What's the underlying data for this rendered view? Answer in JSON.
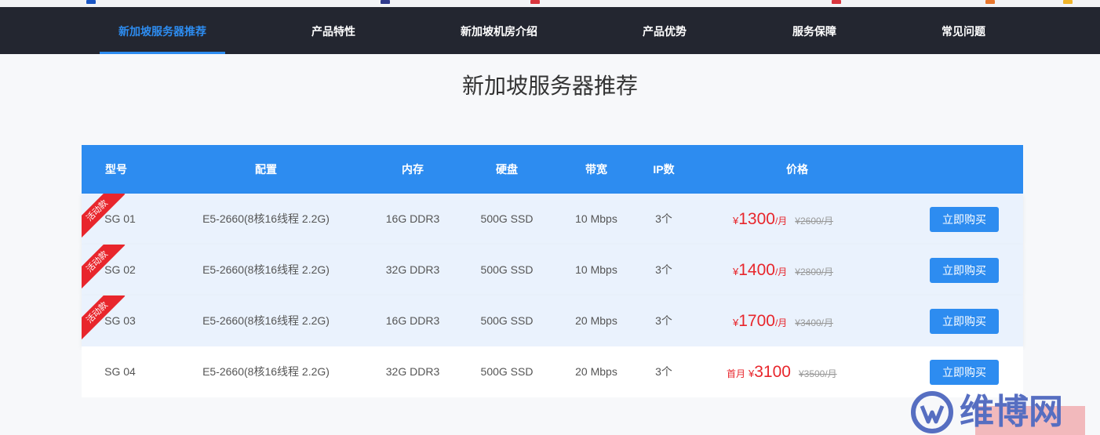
{
  "nav": {
    "items": [
      {
        "label": "新加坡服务器推荐",
        "active": true
      },
      {
        "label": "产品特性",
        "active": false
      },
      {
        "label": "新加坡机房介绍",
        "active": false
      },
      {
        "label": "产品优势",
        "active": false
      },
      {
        "label": "服务保障",
        "active": false
      },
      {
        "label": "常见问题",
        "active": false
      }
    ]
  },
  "page_title": "新加坡服务器推荐",
  "table": {
    "headers": [
      "型号",
      "配置",
      "内存",
      "硬盘",
      "带宽",
      "IP数",
      "价格",
      ""
    ],
    "rows": [
      {
        "promo": true,
        "ribbon": "活动款",
        "model": "SG 01",
        "config": "E5-2660(8核16线程 2.2G)",
        "memory": "16G DDR3",
        "disk": "500G SSD",
        "bandwidth": "10 Mbps",
        "ip": "3个",
        "price_prefix": "",
        "currency": "¥",
        "price": "1300",
        "unit": "/月",
        "old_price": "¥2600/月",
        "button": "立即购买"
      },
      {
        "promo": true,
        "ribbon": "活动款",
        "model": "SG 02",
        "config": "E5-2660(8核16线程 2.2G)",
        "memory": "32G DDR3",
        "disk": "500G SSD",
        "bandwidth": "10 Mbps",
        "ip": "3个",
        "price_prefix": "",
        "currency": "¥",
        "price": "1400",
        "unit": "/月",
        "old_price": "¥2800/月",
        "button": "立即购买"
      },
      {
        "promo": true,
        "ribbon": "活动款",
        "model": "SG 03",
        "config": "E5-2660(8核16线程 2.2G)",
        "memory": "16G DDR3",
        "disk": "500G SSD",
        "bandwidth": "20 Mbps",
        "ip": "3个",
        "price_prefix": "",
        "currency": "¥",
        "price": "1700",
        "unit": "/月",
        "old_price": "¥3400/月",
        "button": "立即购买"
      },
      {
        "promo": false,
        "ribbon": "",
        "model": "SG 04",
        "config": "E5-2660(8核16线程 2.2G)",
        "memory": "32G DDR3",
        "disk": "500G SSD",
        "bandwidth": "20 Mbps",
        "ip": "3个",
        "price_prefix": "首月",
        "currency": "¥",
        "price": "3100",
        "unit": "",
        "old_price": "¥3500/月",
        "button": "立即购买"
      }
    ]
  },
  "watermark": {
    "text": "维博网",
    "icon": "wb-logo-icon"
  },
  "colors": {
    "nav_bg": "#232630",
    "accent": "#2d8cf0",
    "price_red": "#e8262c",
    "promo_row": "#eaf2fd"
  }
}
